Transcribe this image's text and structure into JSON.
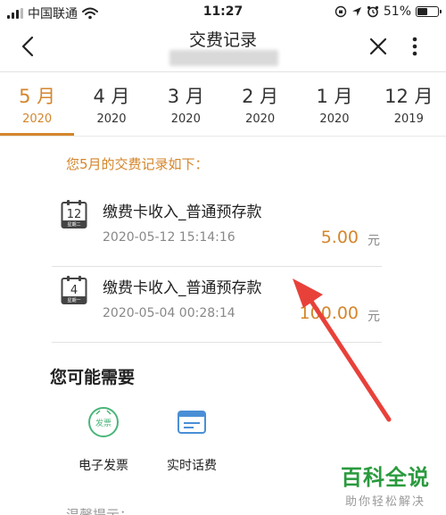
{
  "status_bar": {
    "carrier": "中国联通",
    "time": "11:27",
    "battery": "51%",
    "battery_level": 0.51
  },
  "nav": {
    "title": "交费记录"
  },
  "month_tabs": [
    {
      "month": "5 月",
      "year": "2020",
      "active": true
    },
    {
      "month": "4 月",
      "year": "2020",
      "active": false
    },
    {
      "month": "3 月",
      "year": "2020",
      "active": false
    },
    {
      "month": "2 月",
      "year": "2020",
      "active": false
    },
    {
      "month": "1 月",
      "year": "2020",
      "active": false
    },
    {
      "month": "12 月",
      "year": "2019",
      "active": false
    }
  ],
  "intro": "您5月的交费记录如下：",
  "records": [
    {
      "day": "12",
      "weekday": "星期二",
      "title": "缴费卡收入_普通预存款",
      "datetime": "2020-05-12 15:14:16",
      "amount": "5.00",
      "unit": "元"
    },
    {
      "day": "4",
      "weekday": "星期一",
      "title": "缴费卡收入_普通预存款",
      "datetime": "2020-05-04 00:28:14",
      "amount": "100.00",
      "unit": "元"
    }
  ],
  "maybe_need": {
    "title": "您可能需要",
    "items": [
      {
        "label": "电子发票",
        "icon_text": "发票",
        "icon": "invoice-icon"
      },
      {
        "label": "实时话费",
        "icon": "bill-card-icon"
      }
    ]
  },
  "tip_partial": "温馨提示：",
  "watermark": {
    "main": "百科全说",
    "sub": "助你轻松解决"
  },
  "colors": {
    "accent": "#d4862b",
    "annotation_arrow": "#e8413a",
    "watermark": "#2a9a3e",
    "icon_green": "#4bb57a",
    "icon_blue": "#4a8fd6"
  }
}
